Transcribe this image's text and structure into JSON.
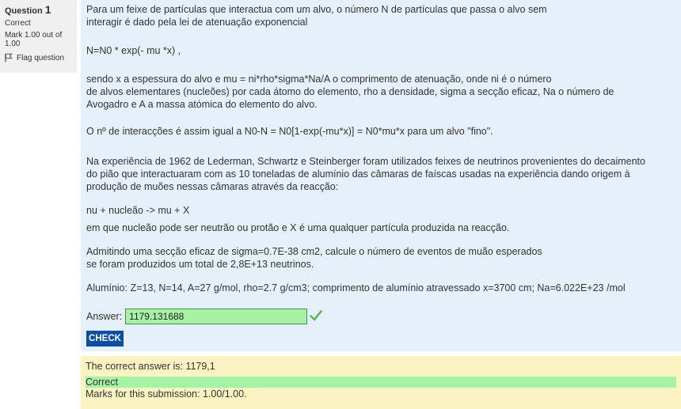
{
  "info": {
    "question_label": "Question",
    "question_number": "1",
    "state": "Correct",
    "grade": "Mark 1.00 out of 1.00",
    "flag_label": "Flag question"
  },
  "question": {
    "paragraphs": [
      [
        "Para um feixe de partículas que interactua com um alvo, o número N de partículas que passa o alvo sem",
        "interagir é dado pela lei de atenuação exponencial"
      ],
      [
        "N=N0 * exp(- mu *x) ,"
      ],
      [
        "sendo x a espessura do alvo e mu = ni*rho*sigma*Na/A o comprimento de atenuação, onde ni é o número",
        "de alvos elementares (nucleões) por cada átomo do elemento, rho a densidade, sigma a secção eficaz, Na o número de",
        "Avogadro e A a massa atómica do elemento do alvo."
      ],
      [
        "O nº de interacções é assim igual a N0-N = N0[1-exp(-mu*x)] = N0*mu*x para um alvo \"fino\"."
      ],
      [
        "Na experiência de 1962 de Lederman, Schwartz e Steinberger foram utilizados feixes de neutrinos provenientes do decaimento",
        "do pião que interactuaram com as 10 toneladas de alumínio das câmaras de faíscas usadas na experiência dando origem à",
        "produção de muões nessas câmaras através da reacção:"
      ],
      [
        "nu + nucleão -> mu + X"
      ],
      [
        "em que nucleão pode ser neutrão ou protão e X é uma qualquer partícula produzida na reacção."
      ],
      [
        "Admitindo uma secção eficaz de sigma=0.7E-38 cm2, calcule o número de eventos de muão esperados",
        "se foram produzidos um total de 2,8E+13 neutrinos."
      ],
      [
        "Alumínio: Z=13, N=14, A=27 g/mol, rho=2.7 g/cm3; comprimento de alumínio atravessado x=3700 cm; Na=6.022E+23 /mol"
      ]
    ],
    "answer_label": "Answer:",
    "answer_value": "1179.131688",
    "check_label": "CHECK"
  },
  "outcome": {
    "correct_answer": "The correct answer is: 1179,1",
    "status": "Correct",
    "marks": "Marks for this submission: 1.00/1.00."
  },
  "colors": {
    "content_bg": "#e6f0fa",
    "outcome_bg": "#fcf3c3",
    "correct_green": "#a6f2a6",
    "button_blue": "#0b4ea2",
    "check_mark": "#5cb85c"
  }
}
